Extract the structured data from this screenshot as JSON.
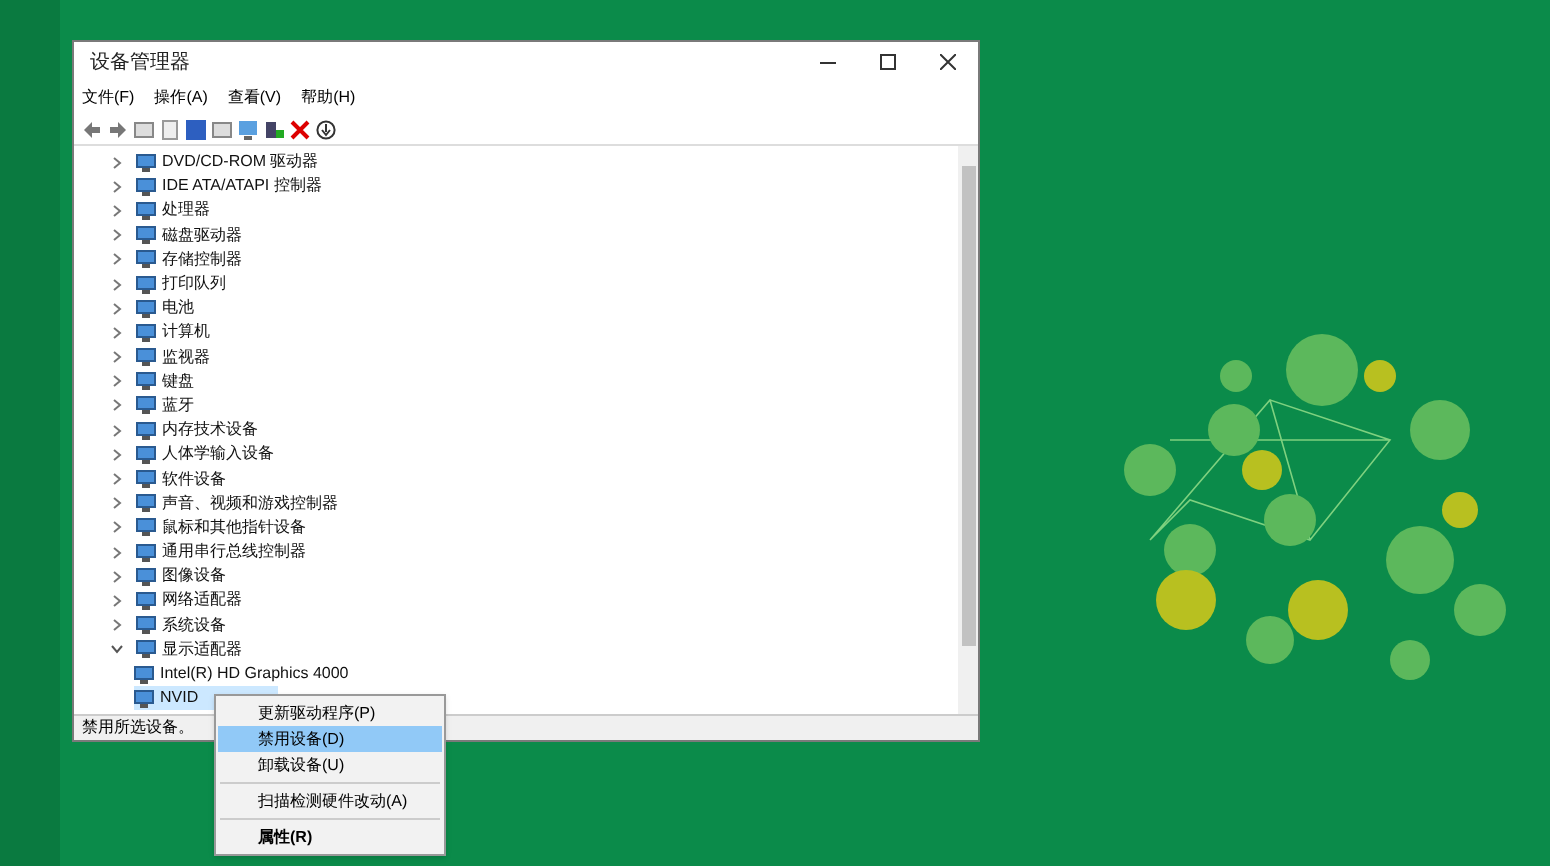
{
  "window": {
    "title": "设备管理器"
  },
  "menu": [
    {
      "label": "文件(F)"
    },
    {
      "label": "操作(A)"
    },
    {
      "label": "查看(V)"
    },
    {
      "label": "帮助(H)"
    }
  ],
  "tree": [
    {
      "label": "DVD/CD-ROM 驱动器",
      "expanded": false,
      "selected": false
    },
    {
      "label": "IDE ATA/ATAPI 控制器",
      "expanded": false,
      "selected": false
    },
    {
      "label": "处理器",
      "expanded": false,
      "selected": false
    },
    {
      "label": "磁盘驱动器",
      "expanded": false,
      "selected": false
    },
    {
      "label": "存储控制器",
      "expanded": false,
      "selected": false
    },
    {
      "label": "打印队列",
      "expanded": false,
      "selected": false
    },
    {
      "label": "电池",
      "expanded": false,
      "selected": false
    },
    {
      "label": "计算机",
      "expanded": false,
      "selected": false
    },
    {
      "label": "监视器",
      "expanded": false,
      "selected": false
    },
    {
      "label": "键盘",
      "expanded": false,
      "selected": false
    },
    {
      "label": "蓝牙",
      "expanded": false,
      "selected": false
    },
    {
      "label": "内存技术设备",
      "expanded": false,
      "selected": false
    },
    {
      "label": "人体学输入设备",
      "expanded": false,
      "selected": false
    },
    {
      "label": "软件设备",
      "expanded": false,
      "selected": false
    },
    {
      "label": "声音、视频和游戏控制器",
      "expanded": false,
      "selected": false
    },
    {
      "label": "鼠标和其他指针设备",
      "expanded": false,
      "selected": false
    },
    {
      "label": "通用串行总线控制器",
      "expanded": false,
      "selected": false
    },
    {
      "label": "图像设备",
      "expanded": false,
      "selected": false
    },
    {
      "label": "网络适配器",
      "expanded": false,
      "selected": false
    },
    {
      "label": "系统设备",
      "expanded": false,
      "selected": false
    },
    {
      "label": "显示适配器",
      "expanded": true,
      "selected": false,
      "children": [
        {
          "label": "Intel(R) HD Graphics 4000",
          "selected": false
        },
        {
          "label": "NVID",
          "selected": true
        }
      ]
    }
  ],
  "status_bar": "禁用所选设备。",
  "context_menu": [
    {
      "kind": "item",
      "label": "更新驱动程序(P)",
      "selected": false,
      "default": false
    },
    {
      "kind": "item",
      "label": "禁用设备(D)",
      "selected": true,
      "default": false
    },
    {
      "kind": "item",
      "label": "卸载设备(U)",
      "selected": false,
      "default": false
    },
    {
      "kind": "separator"
    },
    {
      "kind": "item",
      "label": "扫描检测硬件改动(A)",
      "selected": false,
      "default": false
    },
    {
      "kind": "separator"
    },
    {
      "kind": "item",
      "label": "属性(R)",
      "selected": false,
      "default": true
    }
  ]
}
